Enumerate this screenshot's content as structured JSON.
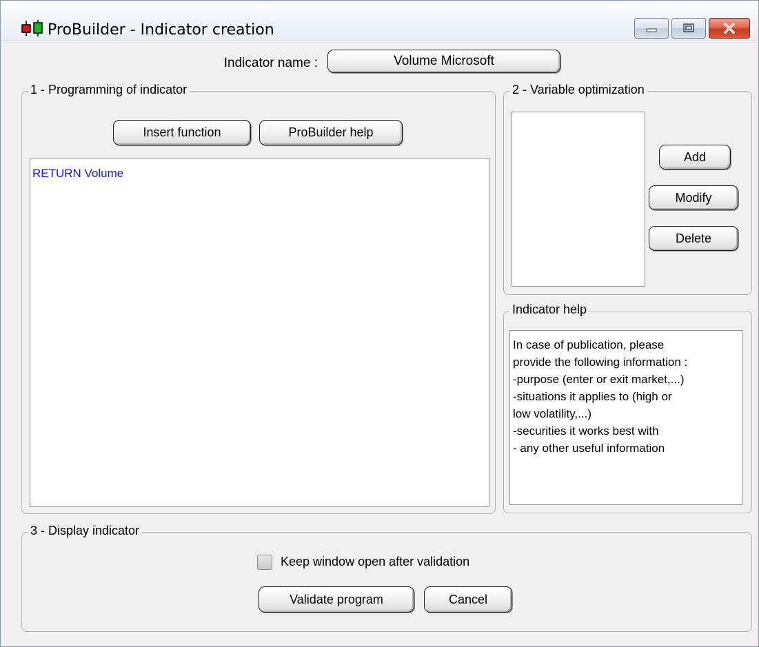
{
  "window": {
    "title": "ProBuilder - Indicator creation",
    "controls": {
      "minimize_icon": "minimize-icon",
      "maximize_icon": "maximize-icon",
      "close_icon": "close-icon"
    },
    "colors": {
      "close_button": "#c73b20",
      "code_text": "#1414ff"
    }
  },
  "indicator": {
    "name_label": "Indicator name :",
    "name_value": "Volume Microsoft"
  },
  "section1": {
    "title": "1 - Programming of indicator",
    "insert_function_label": "Insert function",
    "help_label": "ProBuilder help",
    "code": "RETURN Volume"
  },
  "section2": {
    "title": "2 - Variable optimization",
    "variables": [],
    "add_label": "Add",
    "modify_label": "Modify",
    "delete_label": "Delete"
  },
  "indicator_help": {
    "title": "Indicator help",
    "lines": [
      "In case of publication, please",
      "provide the following information :",
      "-purpose (enter or exit market,...)",
      "-situations it applies to (high or",
      "low volatility,...)",
      "-securities it works best with",
      "- any other useful information"
    ]
  },
  "section3": {
    "title": "3 - Display indicator",
    "keep_open_label": "Keep window open after validation",
    "keep_open_checked": false,
    "validate_label": "Validate program",
    "cancel_label": "Cancel"
  }
}
